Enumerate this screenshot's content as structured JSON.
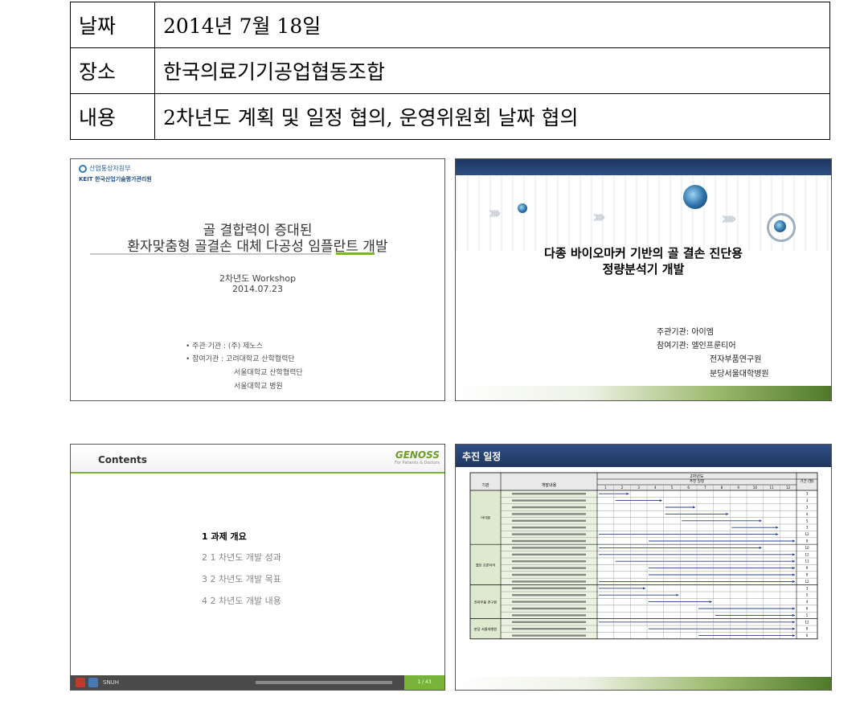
{
  "info": {
    "rows": [
      {
        "label": "날짜",
        "value": "2014년 7월 18일"
      },
      {
        "label": "장소",
        "value": "한국의료기기공업협동조합"
      },
      {
        "label": "내용",
        "value": "2차년도 계획 및 일정 협의, 운영위원회 날짜 협의"
      }
    ]
  },
  "slide1": {
    "ministry": "산업통상자원부",
    "agency": "KEIT 한국산업기술평가관리원",
    "title_line1": "골 결합력이 증대된",
    "title_line2": "환자맞춤형 골결손 대체 다공성 임플란트 개발",
    "workshop": "2차년도 Workshop",
    "date": "2014.07.23",
    "org_lines": [
      "• 주관 기관 : (주) 제노스",
      "• 참여기관 : 고려대학교 산학협력단",
      "서울대학교 산학협력단",
      "서울대학교 병원"
    ]
  },
  "slide2": {
    "title_line1": "다종 바이오마커 기반의 골 결손 진단용",
    "title_line2": "정량분석기 개발",
    "org_lines": [
      "주관기관: 아이엠",
      "참여기관: 엘인프룬티어",
      "전자부품연구원",
      "분당서울대학병원"
    ]
  },
  "slide3": {
    "title": "Contents",
    "brand": "GENOSS",
    "brand_tag": "For Patients & Doctors",
    "items": [
      "1  과제 개요",
      "2  1 차년도 개발 성과",
      "3  2 차년도 개발 목표",
      "4  2 차년도 개발 내용"
    ],
    "footer_logo": "SNUH",
    "page": "1 / 43"
  },
  "slide4": {
    "title": "추진 일정",
    "year_label": "2차년도",
    "col_org": "기관",
    "col_task": "개발내용",
    "col_schedule": "추진 일정",
    "col_period": "기간 (월)",
    "months": [
      "1",
      "2",
      "3",
      "4",
      "5",
      "6",
      "7",
      "8",
      "9",
      "10",
      "11",
      "12"
    ],
    "groups": [
      {
        "name": "아이엠",
        "rows": 8
      },
      {
        "name": "엘인 프론티어",
        "rows": 6
      },
      {
        "name": "전자부품 연구원",
        "rows": 5
      },
      {
        "name": "분당 서울대병원",
        "rows": 3
      }
    ],
    "tasks": [
      {
        "start": 0,
        "end": 2,
        "months": "3"
      },
      {
        "start": 1,
        "end": 4,
        "months": "3"
      },
      {
        "start": 4,
        "end": 6,
        "months": "3"
      },
      {
        "start": 4,
        "end": 8,
        "months": "4"
      },
      {
        "start": 5,
        "end": 10,
        "months": "5"
      },
      {
        "start": 8,
        "end": 11,
        "months": "3"
      },
      {
        "start": 0,
        "end": 11,
        "months": "12"
      },
      {
        "start": 3,
        "end": 12,
        "months": "9"
      },
      {
        "start": 0,
        "end": 10,
        "months": "10"
      },
      {
        "start": 0,
        "end": 12,
        "months": "12"
      },
      {
        "start": 1,
        "end": 12,
        "months": "11"
      },
      {
        "start": 3,
        "end": 12,
        "months": "9"
      },
      {
        "start": 3,
        "end": 12,
        "months": "9"
      },
      {
        "start": 0,
        "end": 12,
        "months": "12"
      },
      {
        "start": 0,
        "end": 3,
        "months": "3"
      },
      {
        "start": 0,
        "end": 5,
        "months": "5"
      },
      {
        "start": 3,
        "end": 7,
        "months": "4"
      },
      {
        "start": 6,
        "end": 12,
        "months": "6"
      },
      {
        "start": 7,
        "end": 12,
        "months": "5"
      },
      {
        "start": 0,
        "end": 12,
        "months": "12"
      },
      {
        "start": 3,
        "end": 12,
        "months": "9"
      },
      {
        "start": 6,
        "end": 12,
        "months": "6"
      }
    ],
    "colors": {
      "header": "#20375f",
      "bar": "#2a3f8f",
      "grid": "#000000",
      "shade": "#dfe9cf"
    }
  }
}
